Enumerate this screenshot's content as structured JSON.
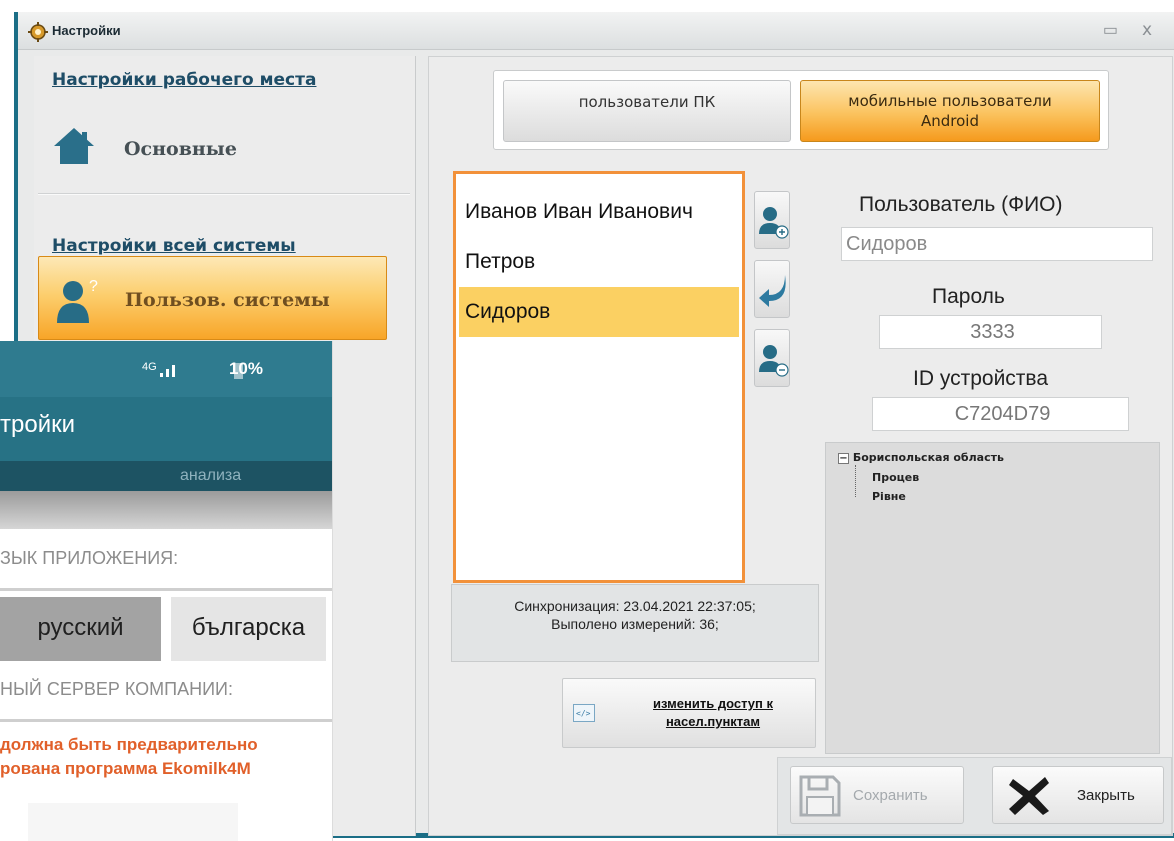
{
  "window": {
    "title": "Настройки",
    "min_glyph": "▭",
    "close_glyph": "x"
  },
  "nav": {
    "workplace_link": "Настройки рабочего места",
    "basic_item": "Основные",
    "system_link": "Настройки всей системы",
    "users_item": "Пользов. системы"
  },
  "tabs": {
    "pc": "пользователи ПК",
    "mobile_line1": "мобильные пользователи",
    "mobile_line2": "Android"
  },
  "users": [
    {
      "name": "Иванов Иван Иванович",
      "selected": false
    },
    {
      "name": "Петров",
      "selected": false
    },
    {
      "name": "Сидоров",
      "selected": true
    }
  ],
  "form": {
    "user_label": "Пользователь (ФИО)",
    "user_value": "Сидоров",
    "password_label": "Пароль",
    "password_value": "3333",
    "device_label": "ID устройства",
    "device_value": "C7204D79"
  },
  "tree": {
    "root": "Бориспольская область",
    "children": [
      "Процев",
      "Рівне"
    ]
  },
  "sync": {
    "line1": "Синхронизация: 23.04.2021 22:37:05;",
    "line2": "Выполено измерений: 36;"
  },
  "access_button": {
    "line1": "изменить доступ к",
    "line2": "насел.пунктам"
  },
  "actions": {
    "save": "Сохранить",
    "close": "Закрыть"
  },
  "android": {
    "network": "4G",
    "battery": "10%",
    "title": "тройки",
    "banner_text": "анализа",
    "lang_label": "ЗЫК ПРИЛОЖЕНИЯ:",
    "lang_ru": "русский",
    "lang_bg": "българска",
    "server_label": "НЫЙ СЕРВЕР КОМПАНИИ:",
    "warn_line1": "должна быть предварительно",
    "warn_line2": "рована программа Ekomilk4M"
  },
  "colors": {
    "accent_orange": "#f59a1d",
    "selection": "#fbd062",
    "window_border": "#1b6e86",
    "android_bar": "#277285",
    "warning": "#e1602a"
  },
  "icons": [
    "settings-gear-icon",
    "home-icon",
    "user-question-icon",
    "add-user-icon",
    "return-arrow-icon",
    "remove-user-icon",
    "code-icon",
    "floppy-disk-icon",
    "big-x-icon"
  ]
}
